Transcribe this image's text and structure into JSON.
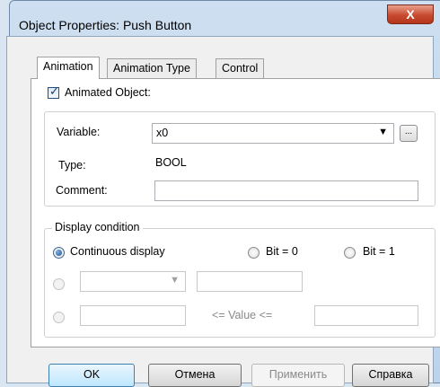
{
  "window": {
    "title": "Object Properties: Push Button",
    "close_glyph": "X"
  },
  "tabs": [
    {
      "label": "Animation",
      "active": true
    },
    {
      "label": "Animation Type",
      "active": false
    },
    {
      "label": "Control",
      "active": false
    }
  ],
  "animated_object": {
    "label": "Animated Object:",
    "checked": true
  },
  "properties": {
    "variable_label": "Variable:",
    "variable_value": "x0",
    "variable_dropdown_glyph": "▼",
    "ellipsis_label": "...",
    "type_label": "Type:",
    "type_value": "BOOL",
    "comment_label": "Comment:",
    "comment_value": ""
  },
  "display_condition": {
    "legend": "Display condition",
    "options": [
      {
        "label": "Continuous display",
        "checked": true
      },
      {
        "label": "Bit = 0",
        "checked": false
      },
      {
        "label": "Bit = 1",
        "checked": false
      }
    ],
    "range_label": "<= Value <=",
    "combo_arrow": "▼"
  },
  "buttons": {
    "ok": "OK",
    "cancel": "Отмена",
    "apply": "Применить",
    "help": "Справка"
  }
}
